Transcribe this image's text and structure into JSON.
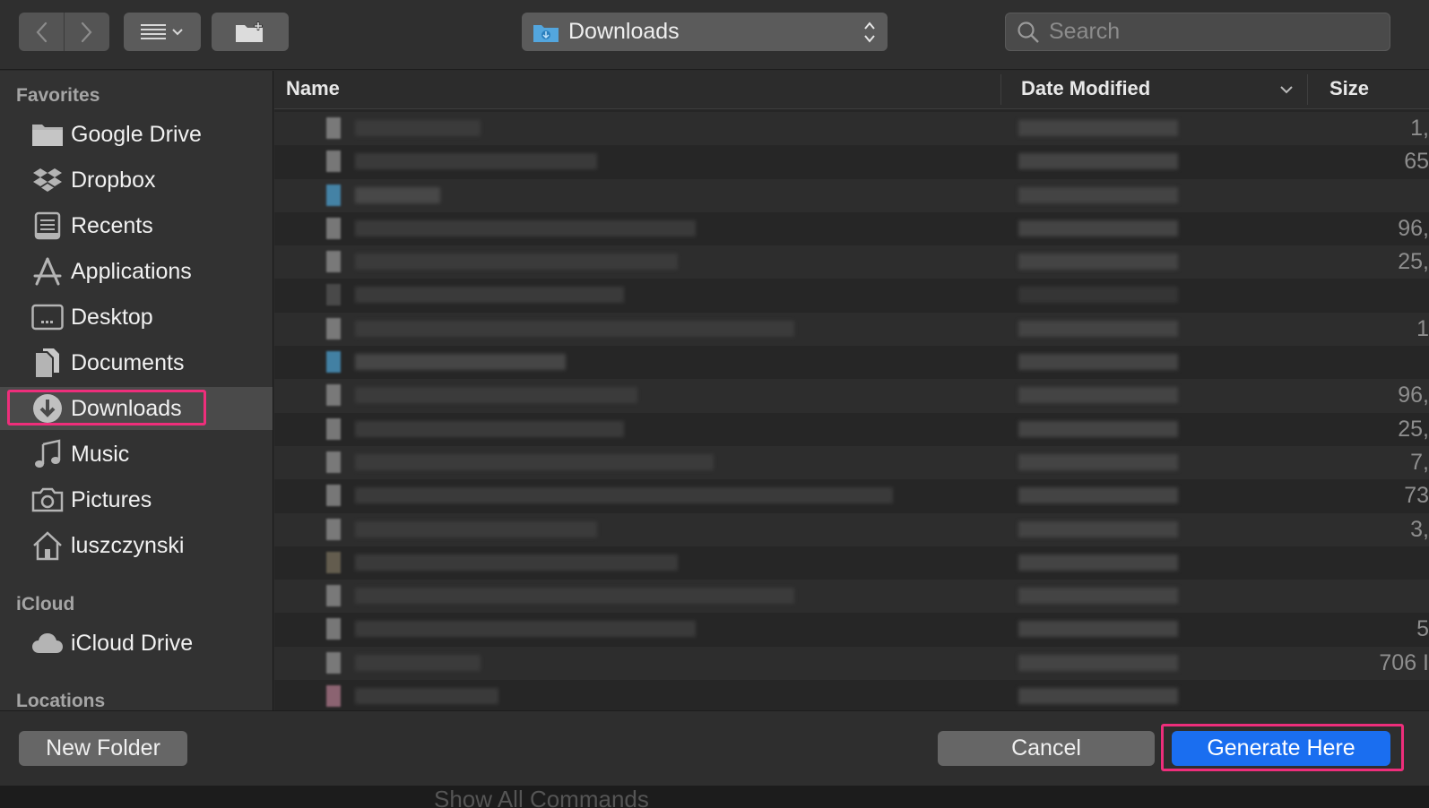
{
  "toolbar": {
    "location": "Downloads",
    "search_placeholder": "Search"
  },
  "sidebar": {
    "sections": [
      {
        "title": "Favorites"
      },
      {
        "title": "iCloud"
      },
      {
        "title": "Locations"
      }
    ],
    "favorites": [
      {
        "label": "Google Drive",
        "icon": "folder-icon"
      },
      {
        "label": "Dropbox",
        "icon": "dropbox-icon"
      },
      {
        "label": "Recents",
        "icon": "recents-icon"
      },
      {
        "label": "Applications",
        "icon": "applications-icon"
      },
      {
        "label": "Desktop",
        "icon": "desktop-icon"
      },
      {
        "label": "Documents",
        "icon": "documents-icon"
      },
      {
        "label": "Downloads",
        "icon": "downloads-icon",
        "selected": true
      },
      {
        "label": "Music",
        "icon": "music-icon"
      },
      {
        "label": "Pictures",
        "icon": "camera-icon"
      },
      {
        "label": "luszczynski",
        "icon": "home-icon"
      }
    ],
    "icloud": [
      {
        "label": "iCloud Drive",
        "icon": "cloud-icon"
      }
    ]
  },
  "columns": {
    "name": "Name",
    "date_modified": "Date Modified",
    "size": "Size"
  },
  "rows": [
    {
      "size": "1,"
    },
    {
      "size": "65"
    },
    {
      "size": ""
    },
    {
      "size": "96,"
    },
    {
      "size": "25,"
    },
    {
      "size": ""
    },
    {
      "size": "1"
    },
    {
      "size": ""
    },
    {
      "size": "96,"
    },
    {
      "size": "25,"
    },
    {
      "size": "7,"
    },
    {
      "size": "73"
    },
    {
      "size": "3,"
    },
    {
      "size": ""
    },
    {
      "size": ""
    },
    {
      "size": "5"
    },
    {
      "size": "706 I"
    },
    {
      "size": ""
    }
  ],
  "buttons": {
    "new_folder": "New Folder",
    "cancel": "Cancel",
    "generate_here": "Generate Here"
  },
  "background_text": "Show All Commands",
  "colors": {
    "accent": "#1a6ef0",
    "highlight": "#ee2e7b"
  }
}
